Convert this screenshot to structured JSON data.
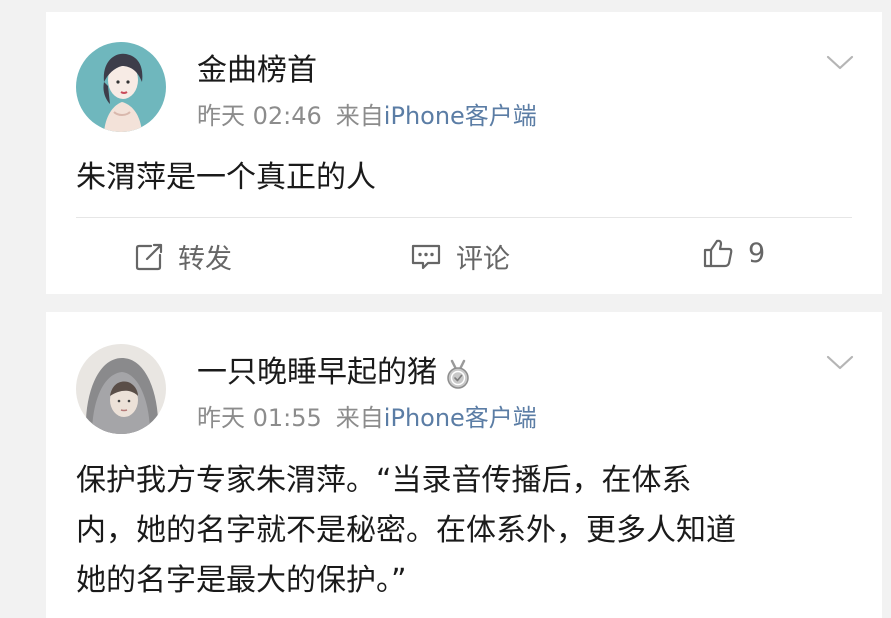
{
  "posts": [
    {
      "username": "金曲榜首",
      "time": "昨天 02:46",
      "source_prefix": "来自",
      "source": "iPhone客户端",
      "content": "朱渭萍是一个真正的人",
      "actions": {
        "repost": "转发",
        "comment": "评论",
        "like_count": "9"
      }
    },
    {
      "username": "一只晚睡早起的猪",
      "time": "昨天 01:55",
      "source_prefix": "来自",
      "source": "iPhone客户端",
      "content": "保护我方专家朱渭萍。“当录音传播后，在体系\n内，她的名字就不是秘密。在体系外，更多人知道\n她的名字是最大的保护。”"
    }
  ],
  "colors": {
    "source_link": "#5b7da5",
    "meta": "#8c8c8c",
    "background": "#f2f2f2"
  },
  "icons": [
    "chevron-down-icon",
    "repost-icon",
    "comment-icon",
    "like-icon",
    "medal-badge-icon"
  ]
}
